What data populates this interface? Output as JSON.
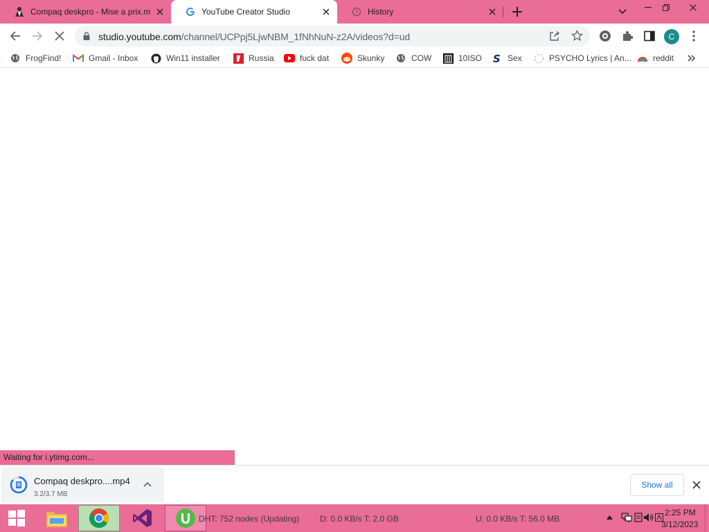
{
  "colors": {
    "accent": "#ea6d97",
    "chrome_bg": "#ffffff",
    "link_blue": "#1a73e8",
    "avatar": "#1a8c8c"
  },
  "tabs": [
    {
      "title": "Compaq deskpro - Mise a prix.m",
      "icon": "person-favicon-icon",
      "active": false
    },
    {
      "title": "YouTube Creator Studio",
      "icon": "google-favicon-icon",
      "active": true
    },
    {
      "title": "History",
      "icon": "history-icon",
      "active": false
    }
  ],
  "toolbar": {
    "url_host": "studio.youtube.com",
    "url_path": "/channel/UCPpj5LjwNBM_1fNhNuN-z2A/videos?d=ud",
    "profile_initial": "C"
  },
  "bookmarks": [
    {
      "label": "FrogFind!",
      "icon": "globe-icon"
    },
    {
      "label": "Gmail - Inbox",
      "icon": "gmail-icon"
    },
    {
      "label": "Win11 installer",
      "icon": "github-icon"
    },
    {
      "label": "Russia",
      "icon": "red-square-icon"
    },
    {
      "label": "fuck dat",
      "icon": "youtube-icon"
    },
    {
      "label": "Skunky",
      "icon": "reddit-icon"
    },
    {
      "label": "COW",
      "icon": "globe-icon"
    },
    {
      "label": "10ISO",
      "icon": "building-icon"
    },
    {
      "label": "Sex",
      "icon": "s-logo-icon"
    },
    {
      "label": "PSYCHO Lyrics | An...",
      "icon": "loading-icon"
    },
    {
      "label": "reddit",
      "icon": "rainbow-icon"
    }
  ],
  "status_text": "Waiting for i.ytimg.com...",
  "download": {
    "name": "Compaq deskpro....mp4",
    "size": "3.2/3.7 MB",
    "progress": 0.86
  },
  "downloads_bar": {
    "show_all": "Show all"
  },
  "taskbar": {
    "torrent_dht": "DHT: 752 nodes (Updating)",
    "torrent_down": "D: 0.0 KB/s T: 2.0 GB",
    "torrent_up": "U: 0.0 KB/s T: 56.0 MB",
    "time": "2:25 PM",
    "date": "3/12/2023"
  }
}
